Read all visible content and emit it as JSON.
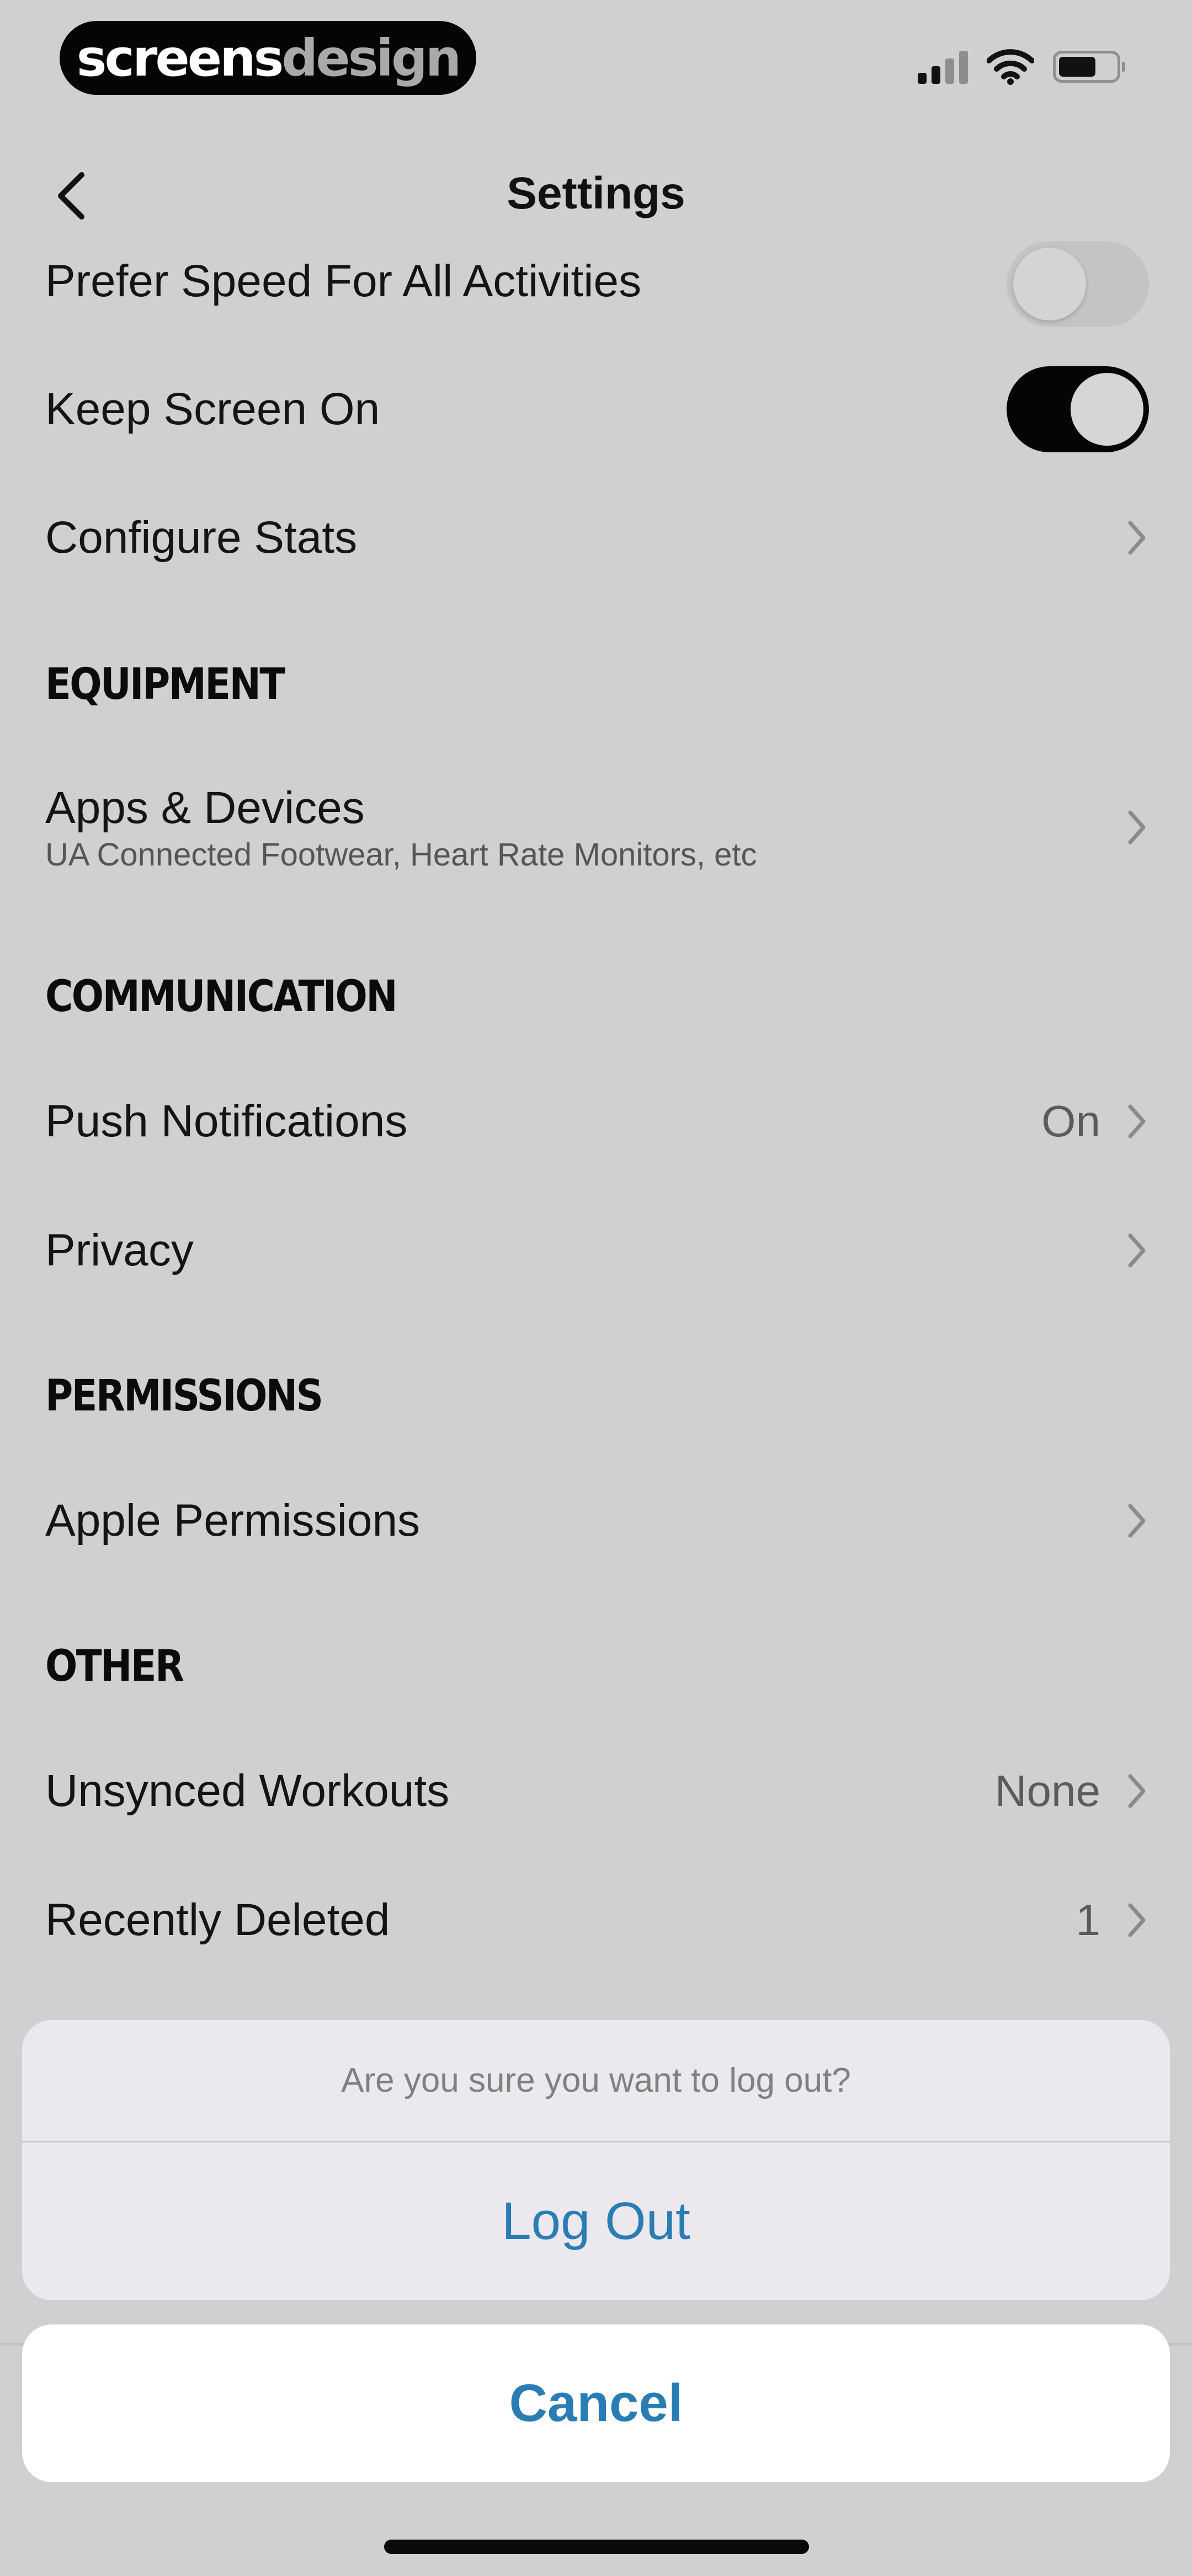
{
  "status_bar": {
    "brand_part1": "screens",
    "brand_part2": "design",
    "icons": [
      "signal-icon",
      "wifi-icon",
      "battery-icon"
    ]
  },
  "nav": {
    "back_icon": "chevron-left-icon",
    "title": "Settings"
  },
  "rows": {
    "prefer_speed": {
      "label": "Prefer Speed For All Activities",
      "toggle": "off"
    },
    "keep_screen_on": {
      "label": "Keep Screen On",
      "toggle": "on"
    },
    "configure_stats": {
      "label": "Configure Stats"
    },
    "apps_devices": {
      "label": "Apps & Devices",
      "sub": "UA Connected Footwear, Heart Rate Monitors, etc"
    },
    "push_notifications": {
      "label": "Push Notifications",
      "value": "On"
    },
    "privacy": {
      "label": "Privacy"
    },
    "apple_permissions": {
      "label": "Apple Permissions"
    },
    "unsynced_workouts": {
      "label": "Unsynced Workouts",
      "value": "None"
    },
    "recently_deleted": {
      "label": "Recently Deleted",
      "value": "1"
    }
  },
  "sections": {
    "equipment": "EQUIPMENT",
    "communication": "COMMUNICATION",
    "permissions": "PERMISSIONS",
    "other": "OTHER"
  },
  "action_sheet": {
    "message": "Are you sure you want to log out?",
    "confirm_label": "Log Out",
    "cancel_label": "Cancel"
  },
  "colors": {
    "background": "#d0cfd2",
    "accent": "#2a7db4",
    "toggle_on": "#050505",
    "sheet_background": "#ebe9ee"
  }
}
